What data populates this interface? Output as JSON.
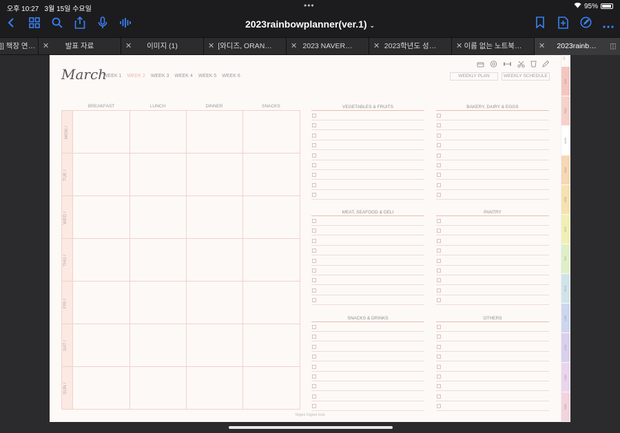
{
  "status": {
    "time": "오후 10:27",
    "date": "3월 15일 수요일",
    "battery": "95%"
  },
  "toolbar": {
    "title": "2023rainbowplanner(ver.1)"
  },
  "tabs": [
    {
      "label": "]] 책장 연…"
    },
    {
      "label": "발표 자료"
    },
    {
      "label": "이미지 (1)"
    },
    {
      "label": "[와디즈, ORAN…"
    },
    {
      "label": "2023 NAVER…"
    },
    {
      "label": "2023학년도 성…"
    },
    {
      "label": "이름 없는 노트북…"
    },
    {
      "label": "2023rainb…"
    }
  ],
  "planner": {
    "month": "March",
    "weeks": [
      "WEEK 1",
      "WEEK 2",
      "WEEK 3",
      "WEEK 4",
      "WEEK 5",
      "WEEK 6"
    ],
    "selected_week": 1,
    "weekly_plan": "WEEKLY PLAN",
    "weekly_schedule": "WEEKLY SCHEDULE",
    "meals": [
      "BREAKFAST",
      "LUNCH",
      "DINNER",
      "SNACKS"
    ],
    "days": [
      "MON /",
      "TUE /",
      "WED /",
      "THU /",
      "FRI /",
      "SAT /",
      "SUN /"
    ],
    "sections": [
      "VEGETABLES & FRUITS",
      "BAKERY, DAIRY & EGGS",
      "MEAT, SEAFOOD & DELI",
      "PANTRY",
      "SNACKS & DRINKS",
      "OTHERS"
    ],
    "months": [
      "JAN",
      "FEB",
      "MAR",
      "APR",
      "MAY",
      "JUN",
      "JUL",
      "AUG",
      "SEP",
      "OCT",
      "NOV",
      "DEC"
    ],
    "footer": "Stigini Digital Hub"
  },
  "colors": {
    "months": [
      "#f3c7c0",
      "#f6d1c9",
      "#ffffff",
      "#f7d7b4",
      "#f8e1b0",
      "#f2efb4",
      "#dff0c6",
      "#cfe4e9",
      "#cdd6ef",
      "#d9d0ee",
      "#ead5ec",
      "#f3d3dc"
    ]
  }
}
